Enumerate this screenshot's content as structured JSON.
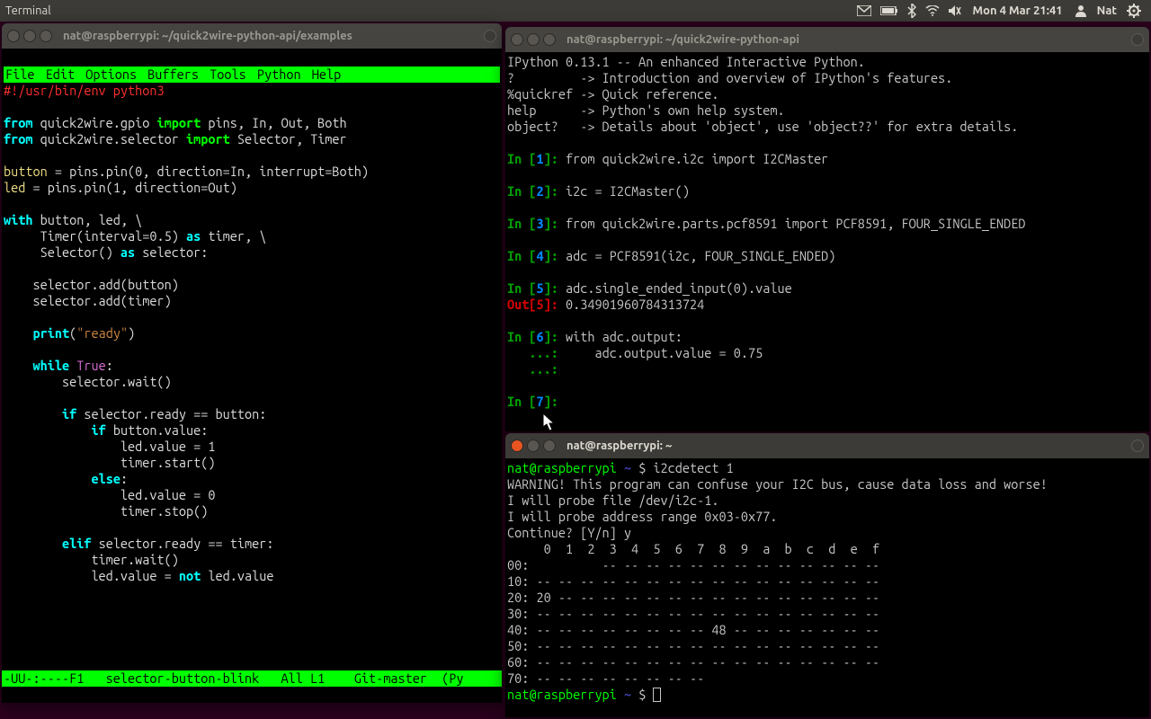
{
  "panel": {
    "title": "Terminal",
    "clock": "Mon  4 Mar 21:41",
    "user": "Nat"
  },
  "windows": {
    "emacs": {
      "title": "nat@raspberrypi: ~/quick2wire-python-api/examples",
      "menu": [
        "File",
        "Edit",
        "Options",
        "Buffers",
        "Tools",
        "Python",
        "Help"
      ],
      "modeline": "-UU-:----F1   selector-button-blink   All L1    Git-master  (Py",
      "code": {
        "shebang": "#!/usr/bin/env python3",
        "lines": [
          {
            "t": "blank"
          },
          {
            "t": "import",
            "mod": "quick2wire.gpio",
            "names": "pins, In, Out, Both"
          },
          {
            "t": "import",
            "mod": "quick2wire.selector",
            "names": "Selector, Timer"
          },
          {
            "t": "blank"
          },
          {
            "t": "assign",
            "lhs": "button",
            "rhs": " = pins.pin(0, direction=In, interrupt=Both)"
          },
          {
            "t": "assign",
            "lhs": "led",
            "rhs": " = pins.pin(1, direction=Out)"
          },
          {
            "t": "blank"
          },
          {
            "t": "with_open"
          },
          {
            "t": "timer_line"
          },
          {
            "t": "selector_line"
          },
          {
            "t": "blank"
          },
          {
            "t": "stmt",
            "txt": "    selector.add(button)"
          },
          {
            "t": "stmt",
            "txt": "    selector.add(timer)"
          },
          {
            "t": "blank"
          },
          {
            "t": "print_ready"
          },
          {
            "t": "blank"
          },
          {
            "t": "while_true"
          },
          {
            "t": "stmt",
            "txt": "        selector.wait()"
          },
          {
            "t": "blank"
          },
          {
            "t": "if_button"
          },
          {
            "t": "if_value"
          },
          {
            "t": "stmt",
            "txt": "                led.value = 1"
          },
          {
            "t": "stmt",
            "txt": "                timer.start()"
          },
          {
            "t": "else"
          },
          {
            "t": "stmt",
            "txt": "                led.value = 0"
          },
          {
            "t": "stmt",
            "txt": "                timer.stop()"
          },
          {
            "t": "blank"
          },
          {
            "t": "elif_timer"
          },
          {
            "t": "stmt",
            "txt": "            timer.wait()"
          },
          {
            "t": "not_line"
          }
        ]
      }
    },
    "ipython": {
      "title": "nat@raspberrypi: ~/quick2wire-python-api",
      "header": [
        "IPython 0.13.1 -- An enhanced Interactive Python.",
        "?         -> Introduction and overview of IPython's features.",
        "%quickref -> Quick reference.",
        "help      -> Python's own help system.",
        "object?   -> Details about 'object', use 'object??' for extra details."
      ],
      "cells": [
        {
          "n": 1,
          "in": "from quick2wire.i2c import I2CMaster"
        },
        {
          "n": 2,
          "in": "i2c = I2CMaster()"
        },
        {
          "n": 3,
          "in": "from quick2wire.parts.pcf8591 import PCF8591, FOUR_SINGLE_ENDED"
        },
        {
          "n": 4,
          "in": "adc = PCF8591(i2c, FOUR_SINGLE_ENDED)"
        },
        {
          "n": 5,
          "in": "adc.single_ended_input(0).value",
          "out": "0.34901960784313724"
        },
        {
          "n": 6,
          "in": "with adc.output:",
          "cont": [
            "    adc.output.value = 0.75",
            ""
          ]
        },
        {
          "n": 7,
          "in": ""
        }
      ]
    },
    "shell": {
      "title": "nat@raspberrypi: ~",
      "prompt_host": "nat@raspberrypi",
      "prompt_path": "~",
      "cmd": "i2cdetect 1",
      "output": [
        "WARNING! This program can confuse your I2C bus, cause data loss and worse!",
        "I will probe file /dev/i2c-1.",
        "I will probe address range 0x03-0x77.",
        "Continue? [Y/n] y",
        "     0  1  2  3  4  5  6  7  8  9  a  b  c  d  e  f",
        "00:          -- -- -- -- -- -- -- -- -- -- -- -- --",
        "10: -- -- -- -- -- -- -- -- -- -- -- -- -- -- -- --",
        "20: 20 -- -- -- -- -- -- -- -- -- -- -- -- -- -- --",
        "30: -- -- -- -- -- -- -- -- -- -- -- -- -- -- -- --",
        "40: -- -- -- -- -- -- -- -- 48 -- -- -- -- -- -- --",
        "50: -- -- -- -- -- -- -- -- -- -- -- -- -- -- -- --",
        "60: -- -- -- -- -- -- -- -- -- -- -- -- -- -- -- --",
        "70: -- -- -- -- -- -- -- --"
      ]
    }
  }
}
